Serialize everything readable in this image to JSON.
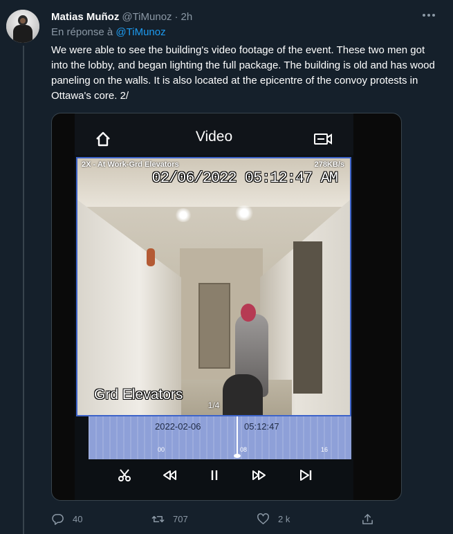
{
  "tweet": {
    "author_name": "Matias Muñoz",
    "author_handle": "@TiMunoz",
    "separator": "·",
    "time": "2h",
    "reply_prefix": "En réponse à",
    "reply_to": "@TiMunoz",
    "text": "We were able to see the building's video footage of the event. These two men got into the lobby, and began lighting the full package. The building is old and has wood paneling on the walls. It is also located at the epicentre of the convoy protests in Ottawa's core. 2/",
    "more_icon": "more-dots-icon"
  },
  "media": {
    "app_title": "Video",
    "home_icon": "home-icon",
    "camera_icon": "camera-switch-icon",
    "camera_label": "2X - At Work-Grd Elevators",
    "bitrate": "278KB/s",
    "timestamp": "02/06/2022 05:12:47 AM",
    "camera_overlay": "Grd Elevators",
    "page_indicator": "1/4",
    "timeline": {
      "date": "2022-02-06",
      "time": "05:12:47",
      "ticks": [
        "00",
        "08",
        "16"
      ]
    },
    "controls": [
      "scissors-icon",
      "rewind-icon",
      "pause-icon",
      "fast-forward-icon",
      "skip-end-icon"
    ]
  },
  "actions": {
    "replies": "40",
    "retweets": "707",
    "likes": "2 k"
  },
  "colors": {
    "background": "#15202b",
    "text_secondary": "#8b98a5",
    "link": "#1d9bf0",
    "timeline": "#8ea0d8",
    "video_border": "#3d63c9"
  }
}
